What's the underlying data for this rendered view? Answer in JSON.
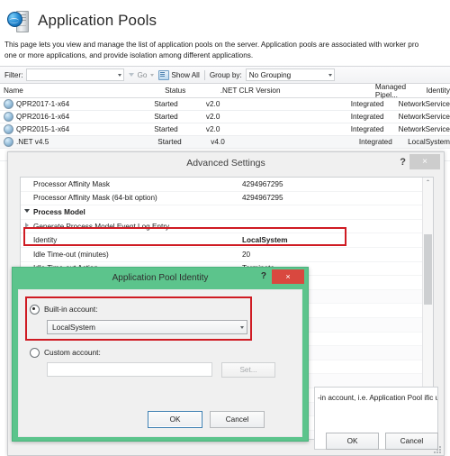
{
  "page": {
    "icon": "application-pools-icon",
    "title": "Application Pools",
    "description_line1": "This page lets you view and manage the list of application pools on the server. Application pools are associated with worker pro",
    "description_line2": "one or more applications, and provide isolation among different applications."
  },
  "filter_bar": {
    "filter_label": "Filter:",
    "filter_value": "",
    "go_label": "Go",
    "show_all_label": "Show All",
    "group_by_label": "Group by:",
    "group_by_value": "No Grouping",
    "funnel_icon": "funnel-icon",
    "show_all_icon": "show-all-icon",
    "caret_icon": "chevron-down-icon"
  },
  "grid": {
    "columns": [
      "Name",
      "Status",
      ".NET CLR Version",
      "Managed Pipel...",
      "Identity"
    ],
    "rows": [
      {
        "name": "QPR2017-1-x64",
        "status": "Started",
        "clr": "v2.0",
        "pipeline": "Integrated",
        "identity": "NetworkService"
      },
      {
        "name": "QPR2016-1-x64",
        "status": "Started",
        "clr": "v2.0",
        "pipeline": "Integrated",
        "identity": "NetworkService"
      },
      {
        "name": "QPR2015-1-x64",
        "status": "Started",
        "clr": "v2.0",
        "pipeline": "Integrated",
        "identity": "NetworkService"
      },
      {
        "name": ".NET v4.5",
        "status": "Started",
        "clr": "v4.0",
        "pipeline": "Integrated",
        "identity": "LocalSystem"
      }
    ]
  },
  "advanced_settings": {
    "title": "Advanced Settings",
    "help_glyph": "?",
    "close_glyph": "×",
    "properties": [
      {
        "name": "Processor Affinity Mask",
        "value": "4294967295",
        "marker": "none",
        "group": false
      },
      {
        "name": "Processor Affinity Mask (64-bit option)",
        "value": "4294967295",
        "marker": "none",
        "group": false
      },
      {
        "name": "Process Model",
        "value": "",
        "marker": "expanded",
        "group": true
      },
      {
        "name": "Generate Process Model Event Log Entry",
        "value": "",
        "marker": "collapsed",
        "group": false
      },
      {
        "name": "Identity",
        "value": "LocalSystem",
        "marker": "none",
        "group": false,
        "highlighted": true
      },
      {
        "name": "Idle Time-out (minutes)",
        "value": "20",
        "marker": "none",
        "group": false
      },
      {
        "name": "Idle Time-out Action",
        "value": "Terminate",
        "marker": "none",
        "group": false
      }
    ],
    "description_text": "-in account, i.e. Application Pool  ific user identity.",
    "ok_label": "OK",
    "cancel_label": "Cancel",
    "scrollbar": {
      "up_glyph": "⌃",
      "down_glyph": "⌄"
    }
  },
  "app_pool_identity": {
    "title": "Application Pool Identity",
    "help_glyph": "?",
    "close_glyph": "×",
    "builtin_label": "Built-in account:",
    "builtin_selected": true,
    "builtin_value": "LocalSystem",
    "custom_label": "Custom account:",
    "custom_selected": false,
    "custom_value": "",
    "set_label": "Set...",
    "ok_label": "OK",
    "cancel_label": "Cancel",
    "caret_icon": "chevron-down-icon"
  },
  "colors": {
    "highlight_red": "#cf1b23",
    "dialog_green": "#5cc48c",
    "close_red": "#d9483f",
    "focus_blue": "#3c7fb1"
  }
}
